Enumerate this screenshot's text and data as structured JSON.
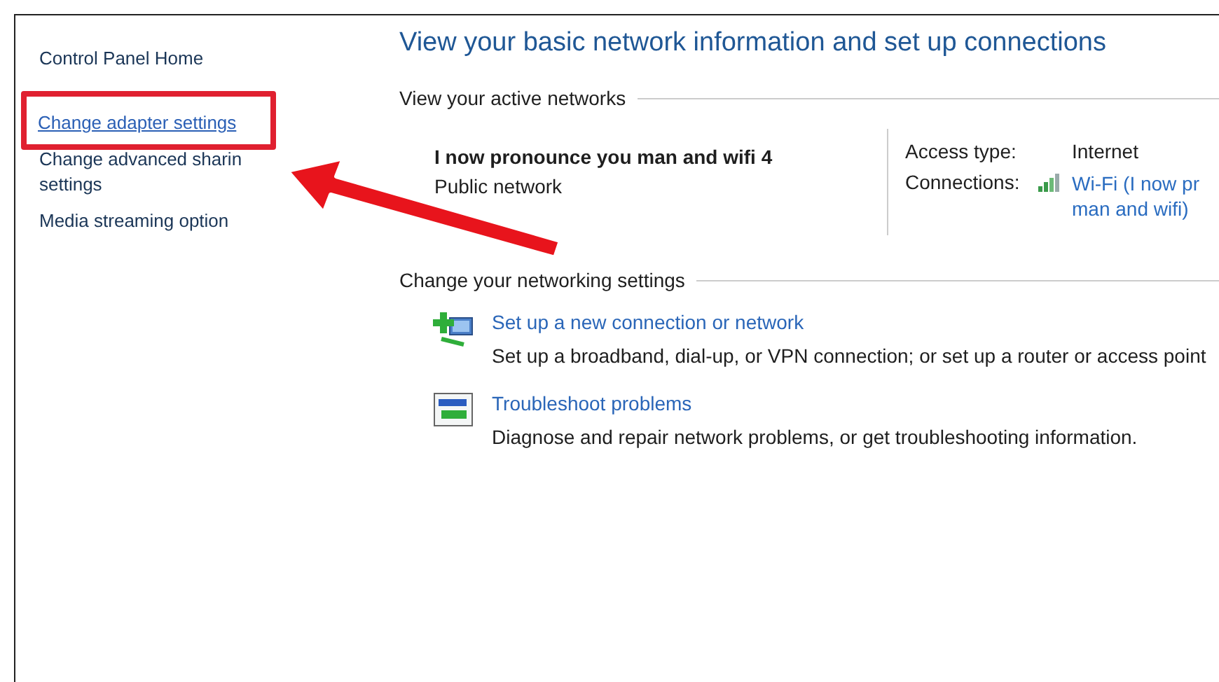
{
  "sidebar": {
    "items": [
      {
        "kind": "text",
        "lines": [
          "Control Panel Home"
        ]
      },
      {
        "kind": "link",
        "lines": [
          "Change adapter settings"
        ],
        "highlighted": true
      },
      {
        "kind": "text",
        "lines": [
          "Change advanced sharin",
          "settings"
        ]
      },
      {
        "kind": "text",
        "lines": [
          "Media streaming option"
        ]
      }
    ]
  },
  "title": "View your basic network information and set up connections",
  "active_networks": {
    "heading": "View your active networks",
    "name": "I now pronounce you man and wifi 4",
    "type": "Public network",
    "access_type_label": "Access type:",
    "access_type": "Internet",
    "connections_label": "Connections:",
    "connection_lines": [
      "Wi-Fi (I now pr",
      "man and wifi)"
    ]
  },
  "settings": {
    "heading": "Change your networking settings",
    "items": [
      {
        "kind": "new-connection",
        "link": "Set up a new connection or network",
        "description": "Set up a broadband, dial-up, or VPN connection; or set up a router or access point"
      },
      {
        "kind": "troubleshoot",
        "link": "Troubleshoot problems",
        "description": "Diagnose and repair network problems, or get troubleshooting information."
      }
    ]
  }
}
